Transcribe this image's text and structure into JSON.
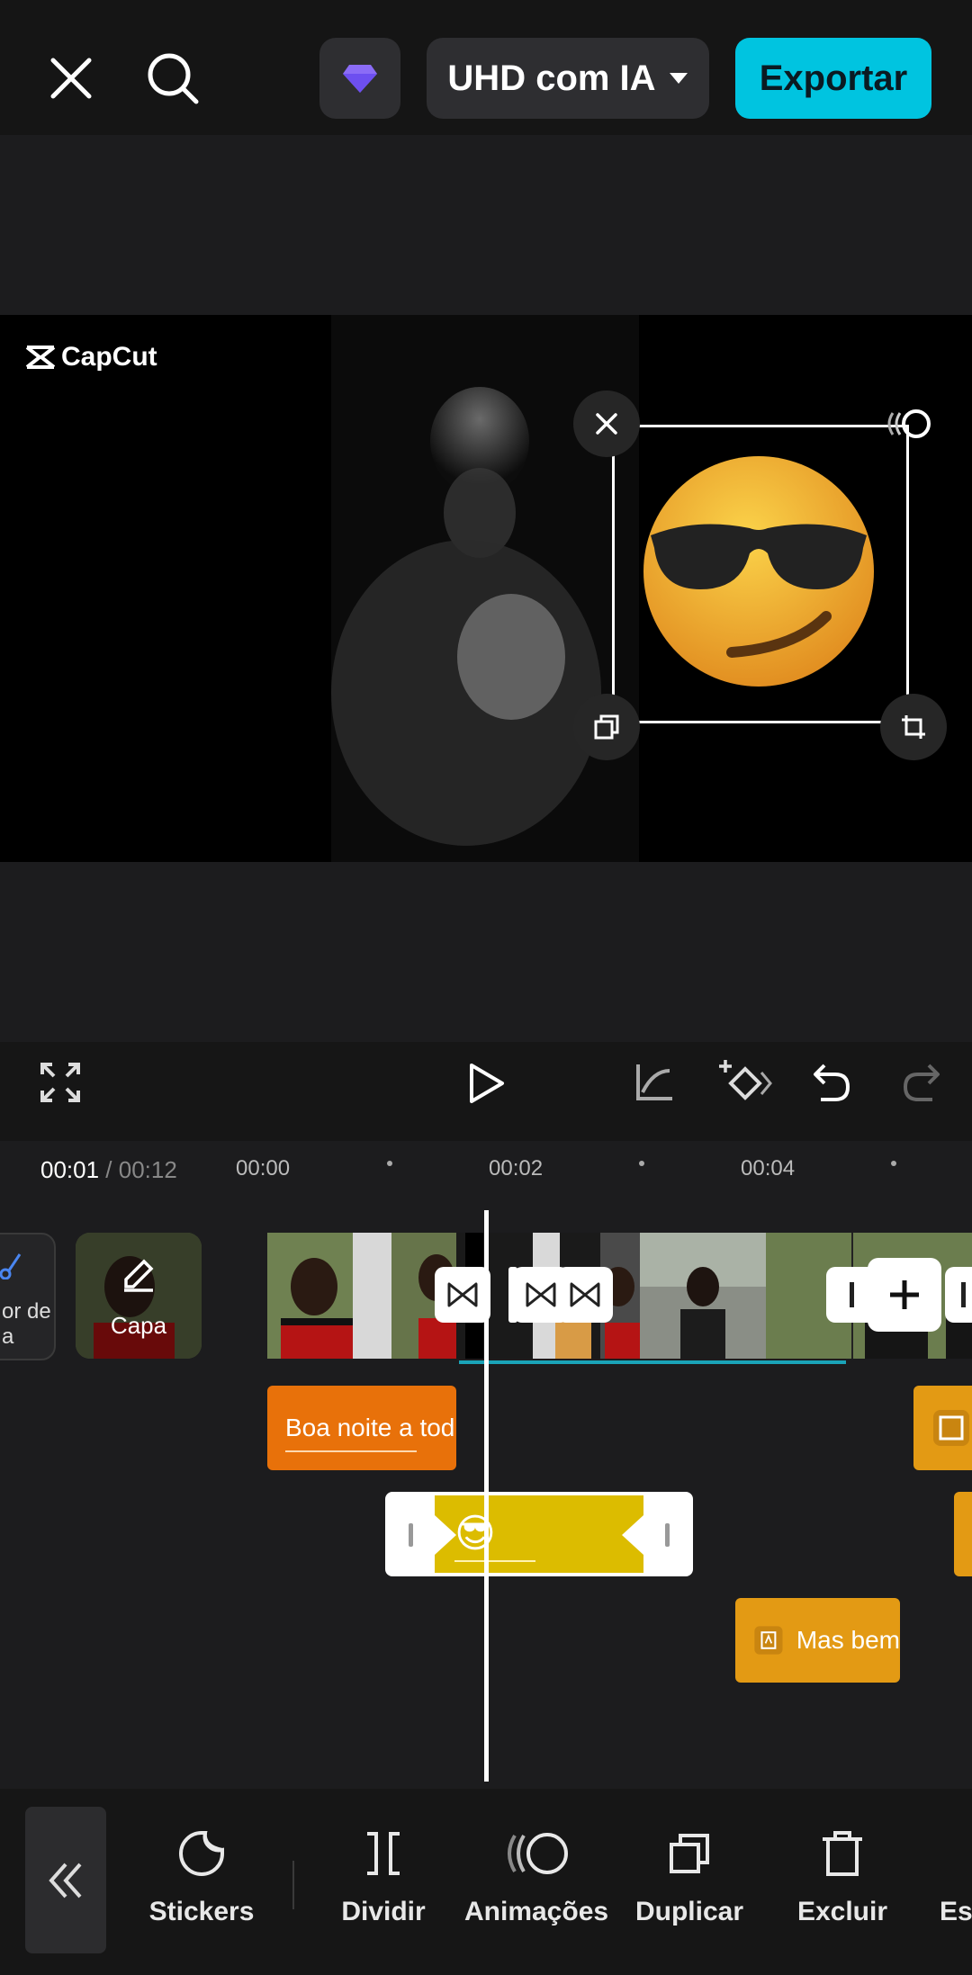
{
  "topbar": {
    "close_icon": "close-icon",
    "search_icon": "search-icon",
    "premium_icon": "diamond-icon",
    "quality_label": "UHD com IA",
    "export_label": "Exportar"
  },
  "preview": {
    "watermark_text": "CapCut",
    "sticker_emoji": "😏"
  },
  "controls": {
    "fullscreen_icon": "fullscreen-icon",
    "play_icon": "play-icon",
    "graph_icon": "graph-icon",
    "keyframe_icon": "keyframe-add-icon",
    "undo_icon": "undo-icon",
    "redo_icon": "redo-icon"
  },
  "ruler": {
    "current_time": "00:01",
    "separator": " / ",
    "total_time": "00:12",
    "ticks": [
      "00:00",
      "00:02",
      "00:04"
    ]
  },
  "timeline": {
    "left_tool_label": "or de",
    "left_tool_label_2": "a",
    "cover_label": "Capa",
    "text_clip_1": "Boa noite a tod",
    "text_clip_2": "Mas bem",
    "sticker_clip_emoji": "😎"
  },
  "toolbar": {
    "collapse_icon": "double-chevron-left-icon",
    "items": [
      {
        "label": "Stickers",
        "icon": "sticker-icon"
      },
      {
        "label": "Dividir",
        "icon": "split-icon"
      },
      {
        "label": "Animações",
        "icon": "animation-icon"
      },
      {
        "label": "Duplicar",
        "icon": "duplicate-icon"
      },
      {
        "label": "Excluir",
        "icon": "trash-icon"
      },
      {
        "label": "Esp",
        "icon": "mirror-icon"
      }
    ]
  },
  "colors": {
    "accent": "#00c4e0",
    "text_clip": "#e8710a",
    "sticker_clip": "#dcbc00",
    "background": "#1c1c1e"
  }
}
